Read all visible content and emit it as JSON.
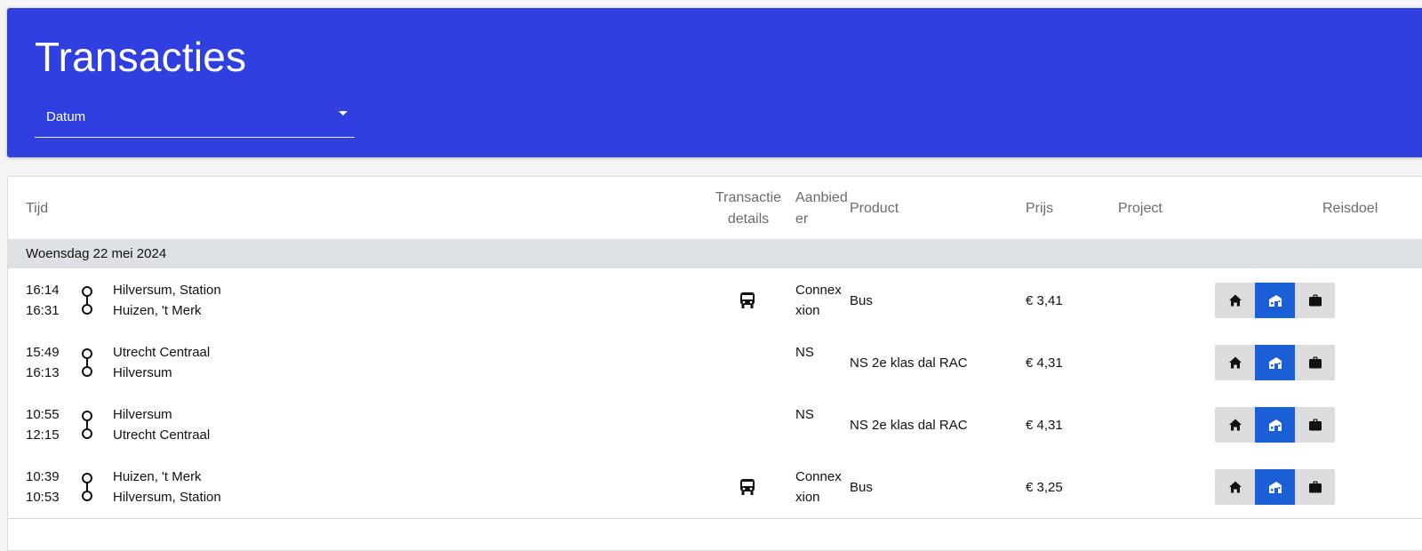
{
  "header": {
    "title": "Transacties",
    "date_filter": {
      "label": "Datum"
    }
  },
  "colors": {
    "header_bg": "#2f3fe0",
    "active_purpose": "#1b5fd6"
  },
  "table": {
    "columns": {
      "time": "Tijd",
      "details_line1": "Transactie",
      "details_line2": "details",
      "provider_line1": "Aanbied",
      "provider_line2": "er",
      "product": "Product",
      "price": "Prijs",
      "project": "Project",
      "purpose": "Reisdoel"
    },
    "group": {
      "label": "Woensdag 22 mei 2024"
    },
    "rows": [
      {
        "start_time": "16:14",
        "end_time": "16:31",
        "from": "Hilversum, Station",
        "to": "Huizen, 't Merk",
        "detail_icon": "bus-icon",
        "provider_line1": "Connex",
        "provider_line2": "xion",
        "product": "Bus",
        "price": "€ 3,41",
        "project": "",
        "purpose_selected": "commute"
      },
      {
        "start_time": "15:49",
        "end_time": "16:13",
        "from": "Utrecht Centraal",
        "to": "Hilversum",
        "detail_icon": "",
        "provider_line1": "NS",
        "provider_line2": "",
        "product": "NS 2e klas dal RAC",
        "price": "€ 4,31",
        "project": "",
        "purpose_selected": "commute"
      },
      {
        "start_time": "10:55",
        "end_time": "12:15",
        "from": "Hilversum",
        "to": "Utrecht Centraal",
        "detail_icon": "",
        "provider_line1": "NS",
        "provider_line2": "",
        "product": "NS 2e klas dal RAC",
        "price": "€ 4,31",
        "project": "",
        "purpose_selected": "commute"
      },
      {
        "start_time": "10:39",
        "end_time": "10:53",
        "from": "Huizen, 't Merk",
        "to": "Hilversum, Station",
        "detail_icon": "bus-icon",
        "provider_line1": "Connex",
        "provider_line2": "xion",
        "product": "Bus",
        "price": "€ 3,25",
        "project": "",
        "purpose_selected": "commute"
      }
    ],
    "purpose_options": [
      "home-icon",
      "commute-icon",
      "briefcase-icon"
    ]
  }
}
